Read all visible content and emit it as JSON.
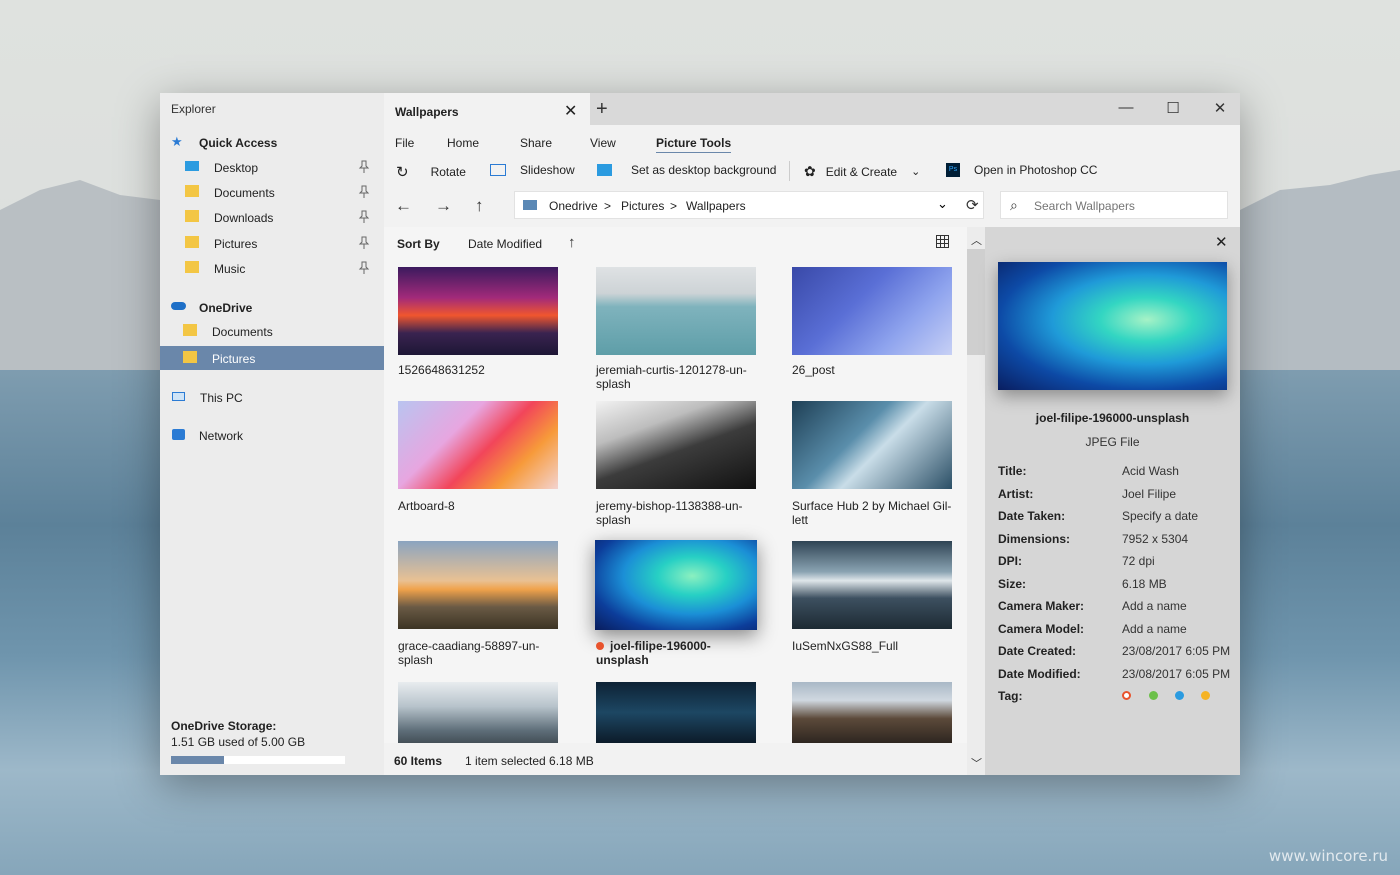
{
  "watermark": "www.wincore.ru",
  "sidebar": {
    "app_title": "Explorer",
    "quick_access": "Quick Access",
    "quick_items": [
      {
        "label": "Desktop"
      },
      {
        "label": "Documents"
      },
      {
        "label": "Downloads"
      },
      {
        "label": "Pictures"
      },
      {
        "label": "Music"
      }
    ],
    "onedrive": "OneDrive",
    "onedrive_items": [
      {
        "label": "Documents"
      },
      {
        "label": "Pictures"
      }
    ],
    "this_pc": "This PC",
    "network": "Network",
    "storage": {
      "label": "OneDrive Storage:",
      "text": "1.51 GB used of 5.00 GB",
      "used_gb": 1.51,
      "total_gb": 5.0
    }
  },
  "tab": {
    "label": "Wallpapers"
  },
  "ribbon": {
    "tabs": [
      "File",
      "Home",
      "Share",
      "View",
      "Picture Tools"
    ],
    "active": "Picture Tools",
    "actions": {
      "rotate": "Rotate",
      "slideshow": "Slideshow",
      "set_bg": "Set as desktop background",
      "edit_create": "Edit & Create",
      "photoshop": "Open in Photoshop CC"
    }
  },
  "address": {
    "crumbs": [
      "Onedrive",
      "Pictures",
      "Wallpapers"
    ],
    "separator": ">",
    "search_placeholder": "Search Wallpapers"
  },
  "sort": {
    "label": "Sort By",
    "value": "Date Modified"
  },
  "files": [
    {
      "name": "1526648631252"
    },
    {
      "name": "jeremiah-curtis-1201278-un-splash"
    },
    {
      "name": "26_post"
    },
    {
      "name": "Artboard-8"
    },
    {
      "name": "jeremy-bishop-1138388-un-splash"
    },
    {
      "name": "Surface Hub 2 by Michael Gil-lett"
    },
    {
      "name": "grace-caadiang-58897-un-splash"
    },
    {
      "name": "joel-filipe-196000-unsplash"
    },
    {
      "name": "IuSemNxGS88_Full"
    }
  ],
  "status": {
    "items": "60 Items",
    "selection": "1 item selected 6.18 MB"
  },
  "details": {
    "name": "joel-filipe-196000-unsplash",
    "type": "JPEG File",
    "props": [
      {
        "k": "Title:",
        "v": "Acid Wash"
      },
      {
        "k": "Artist:",
        "v": "Joel Filipe"
      },
      {
        "k": "Date Taken:",
        "v": "Specify a date"
      },
      {
        "k": "Dimensions:",
        "v": "7952 x 5304"
      },
      {
        "k": "DPI:",
        "v": "72 dpi"
      },
      {
        "k": "Size:",
        "v": "6.18 MB"
      },
      {
        "k": "Camera Maker:",
        "v": "Add a name"
      },
      {
        "k": "Camera Model:",
        "v": "Add a name"
      },
      {
        "k": "Date Created:",
        "v": "23/08/2017 6:05 PM"
      },
      {
        "k": "Date Modified:",
        "v": "23/08/2017 6:05 PM"
      }
    ],
    "tag_label": "Tag:",
    "tags": [
      "#e8532d",
      "#6cc04a",
      "#2b9be0",
      "#f5b324"
    ]
  },
  "colors": {
    "accent": "#6a87aa",
    "selected_dot": "#e8532d"
  }
}
